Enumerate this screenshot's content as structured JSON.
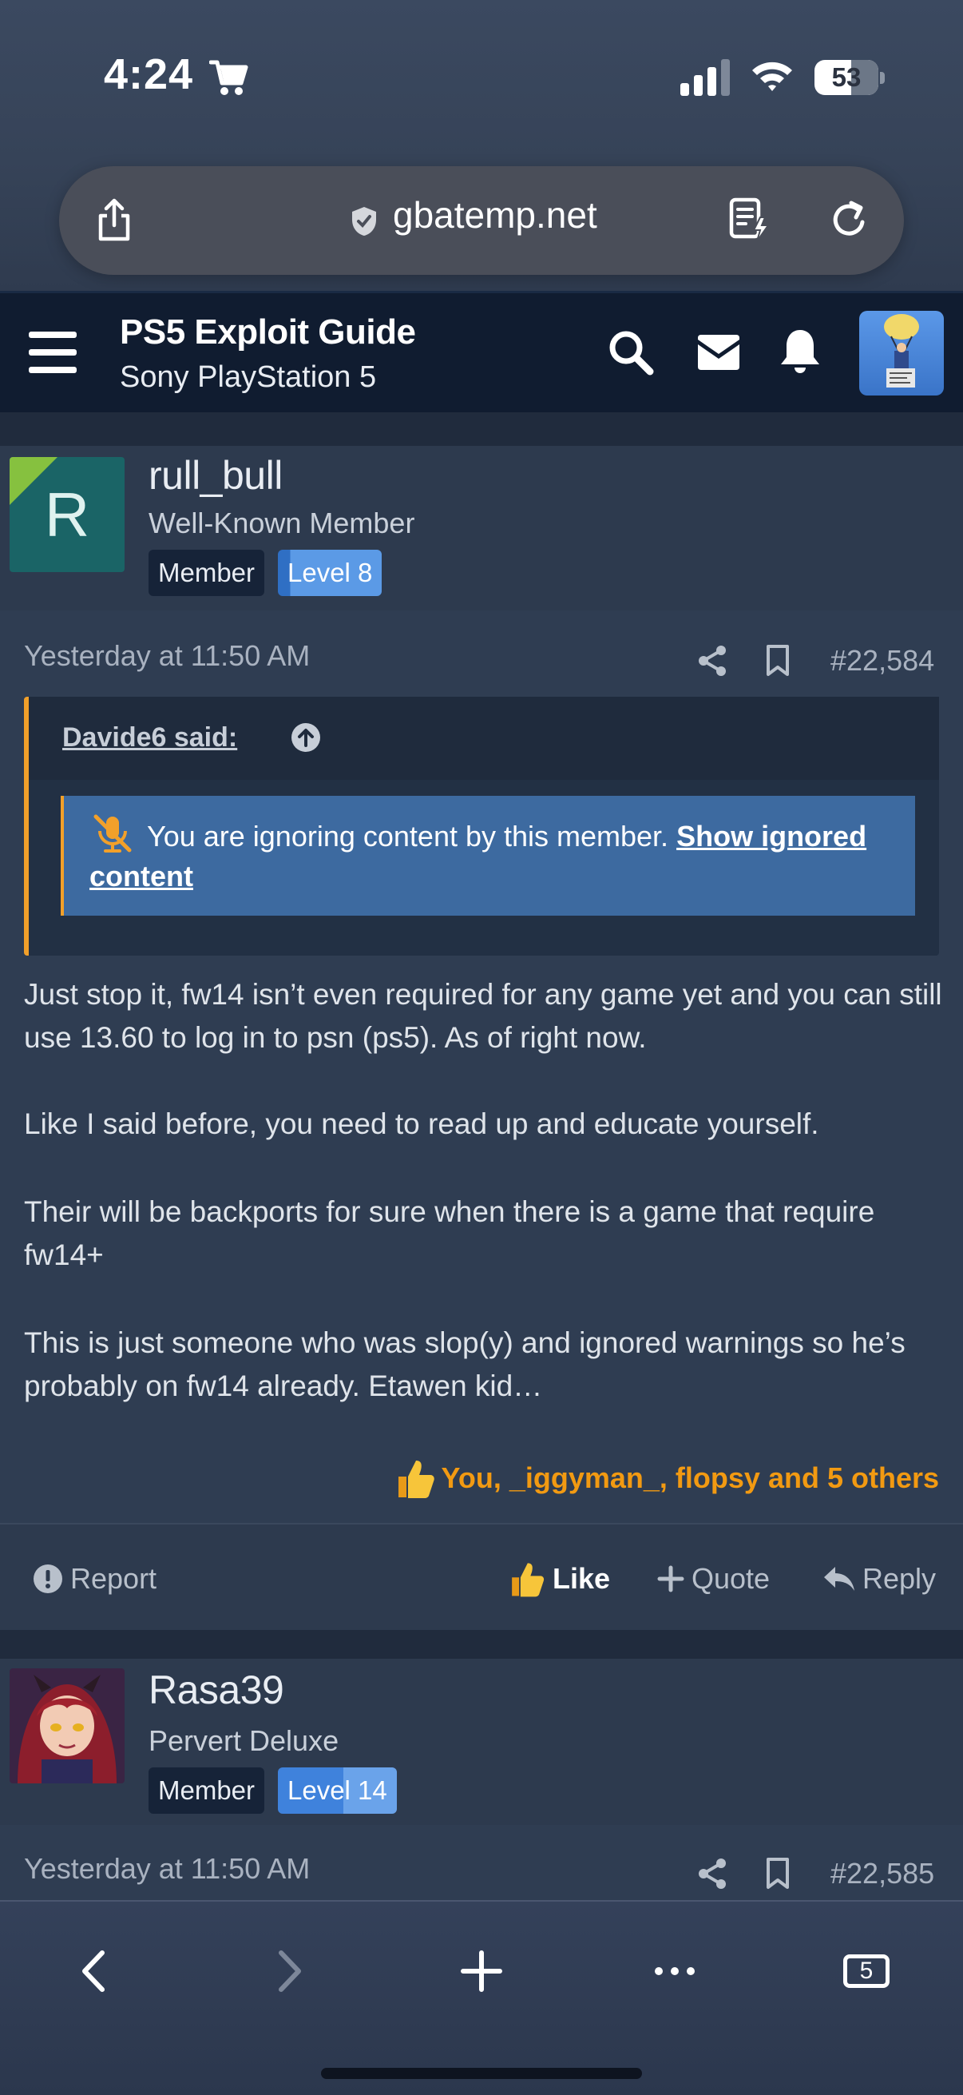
{
  "status_bar": {
    "time": "4:24",
    "battery": "53"
  },
  "browser": {
    "url": "gbatemp.net",
    "tab_count": "5"
  },
  "site_header": {
    "thread_title": "PS5 Exploit Guide",
    "forum_name": "Sony PlayStation 5"
  },
  "posts": [
    {
      "username": "rull_bull",
      "avatar_letter": "R",
      "user_title": "Well-Known Member",
      "badge_member": "Member",
      "badge_level": "Level 8",
      "level_progress": 0.05,
      "date": "Yesterday at 11:50 AM",
      "number": "#22,584",
      "quote": {
        "author": "Davide6 said:",
        "ignore_text": "You are ignoring content by this member.",
        "ignore_link": "Show ignored content"
      },
      "paragraphs": [
        "Just stop it, fw14 isn’t even required for any game yet and you can still use 13.60 to log in to psn (ps5). As of right now.",
        "Like I said before, you need to read up and educate yourself.",
        "Their will be backports for sure when there is a game that require fw14+",
        "This is just someone who was slop(y) and ignored warnings so he’s probably on fw14 already. Etawen kid…"
      ],
      "reactions": "You, _iggyman_, flopsy and 5 others",
      "actions": {
        "report": "Report",
        "like": "Like",
        "quote": "Quote",
        "reply": "Reply"
      }
    },
    {
      "username": "Rasa39",
      "user_title": "Pervert Deluxe",
      "badge_member": "Member",
      "badge_level": "Level 14",
      "level_progress": 0.55,
      "date": "Yesterday at 11:50 AM",
      "number": "#22,585"
    }
  ],
  "colors": {
    "accent_orange": "#f29a12",
    "level_badge_blue": "#4d8ee0",
    "header_bg": "#101c30"
  }
}
